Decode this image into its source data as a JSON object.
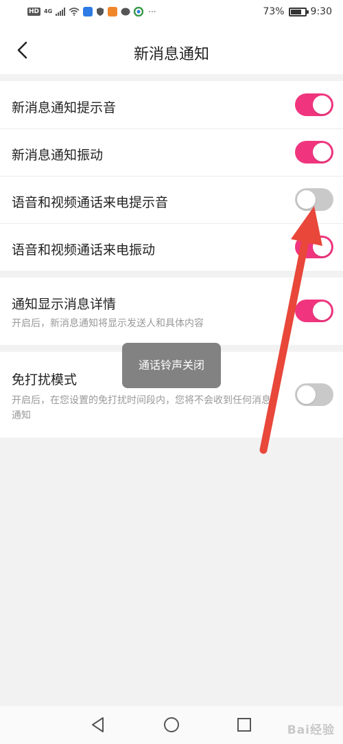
{
  "status_bar": {
    "hd": "HD",
    "network": "4G",
    "more": "···",
    "battery_text": "73%",
    "battery_level": 0.73,
    "time": "9:30"
  },
  "header": {
    "title": "新消息通知",
    "back_icon": "chevron-left-icon"
  },
  "settings": {
    "group1": [
      {
        "label": "新消息通知提示音",
        "enabled": true
      },
      {
        "label": "新消息通知振动",
        "enabled": true
      },
      {
        "label": "语音和视频通话来电提示音",
        "enabled": false
      },
      {
        "label": "语音和视频通话来电振动",
        "enabled": true
      }
    ],
    "group2": {
      "label": "通知显示消息详情",
      "description": "开启后，新消息通知将显示发送人和具体内容",
      "enabled": true
    },
    "group3": {
      "label": "免打扰模式",
      "description": "开启后，在您设置的免打扰时间段内，您将不会收到任何消息通知",
      "enabled": false
    }
  },
  "toast": {
    "text": "通话铃声关闭"
  },
  "watermark": {
    "text": "Bai经验"
  },
  "colors": {
    "toggle_on": "#f0357e",
    "toggle_off": "#c9c9c9",
    "arrow": "#e8473a"
  },
  "icons": {
    "nav_back": "triangle-back-icon",
    "nav_home": "circle-home-icon",
    "nav_recents": "square-recents-icon"
  }
}
